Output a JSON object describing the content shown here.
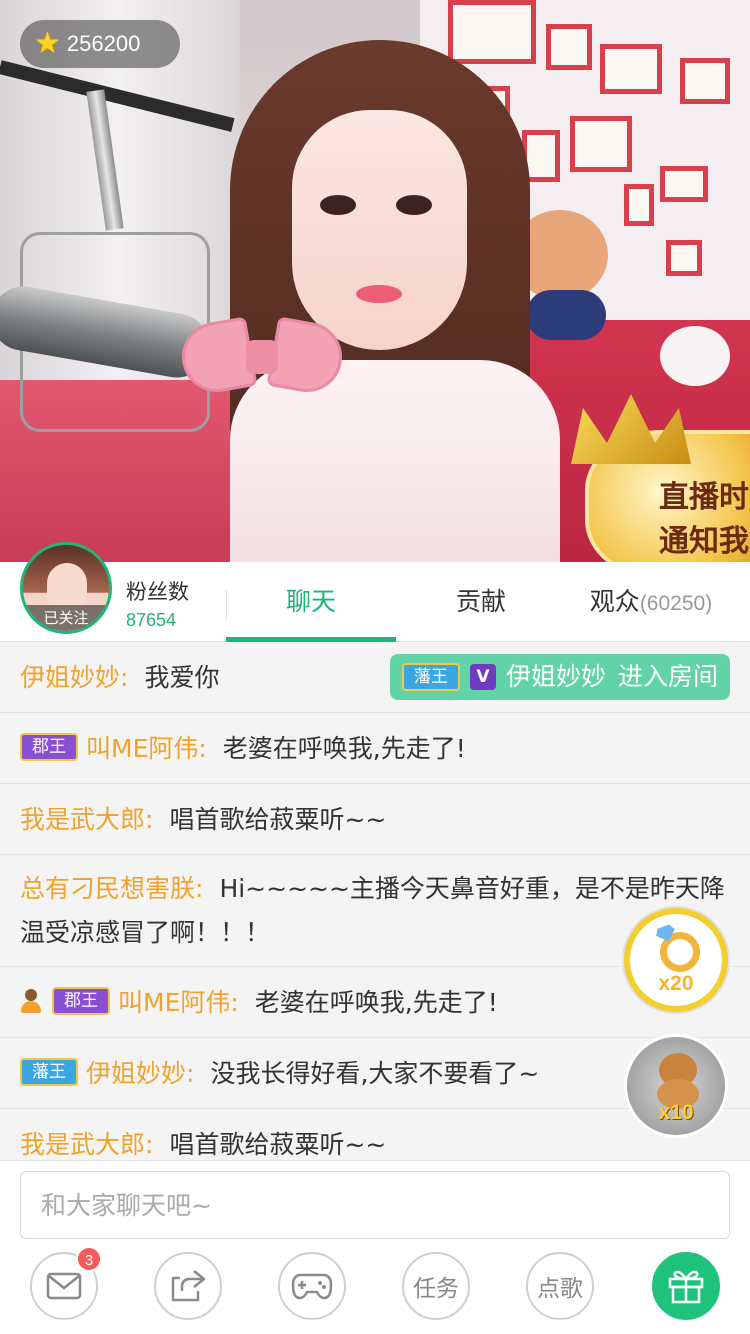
{
  "stream": {
    "coins": "256200",
    "notify_text": [
      "直播时",
      "通知我"
    ]
  },
  "anchor": {
    "followed_label": "已关注",
    "fans_label": "粉丝数",
    "fans_count": "87654"
  },
  "tabs": [
    {
      "label": "聊天",
      "sub": ""
    },
    {
      "label": "贡献",
      "sub": ""
    },
    {
      "label": "观众",
      "sub": "(60250)"
    }
  ],
  "chat": {
    "messages": [
      {
        "name": "伊姐妙妙:",
        "text": "我爱你"
      },
      {
        "badge": "郡王",
        "name": "叫ME阿伟:",
        "text": "老婆在呼唤我,先走了!"
      },
      {
        "name": "我是武大郎:",
        "text": "唱首歌给菽粟听~~"
      },
      {
        "name": "总有刁民想害朕:",
        "text": "Hi~~~~~主播今天鼻音好重，是不是昨天降温受凉感冒了啊！！！"
      },
      {
        "badge": "郡王",
        "name": "叫ME阿伟:",
        "text": "老婆在呼唤我,先走了!"
      },
      {
        "badge": "藩王",
        "name": "伊姐妙妙:",
        "text": "没我长得好看,大家不要看了~"
      },
      {
        "name": "我是武大郎:",
        "text": "唱首歌给菽粟听~~"
      }
    ],
    "enter_notice": {
      "badge": "藩王",
      "vip": "V",
      "name": "伊姐妙妙",
      "action": "进入房间"
    }
  },
  "gifts": [
    {
      "icon": "ring-icon",
      "multiplier": "x20"
    },
    {
      "icon": "teddy-bear-icon",
      "multiplier": "x10"
    }
  ],
  "input": {
    "placeholder": "和大家聊天吧~"
  },
  "toolbar": {
    "mail_badge": "3",
    "task_label": "任务",
    "song_label": "点歌"
  },
  "colors": {
    "accent": "#1fb574",
    "name": "#f0a22c",
    "gift_button": "#1fc27b"
  }
}
